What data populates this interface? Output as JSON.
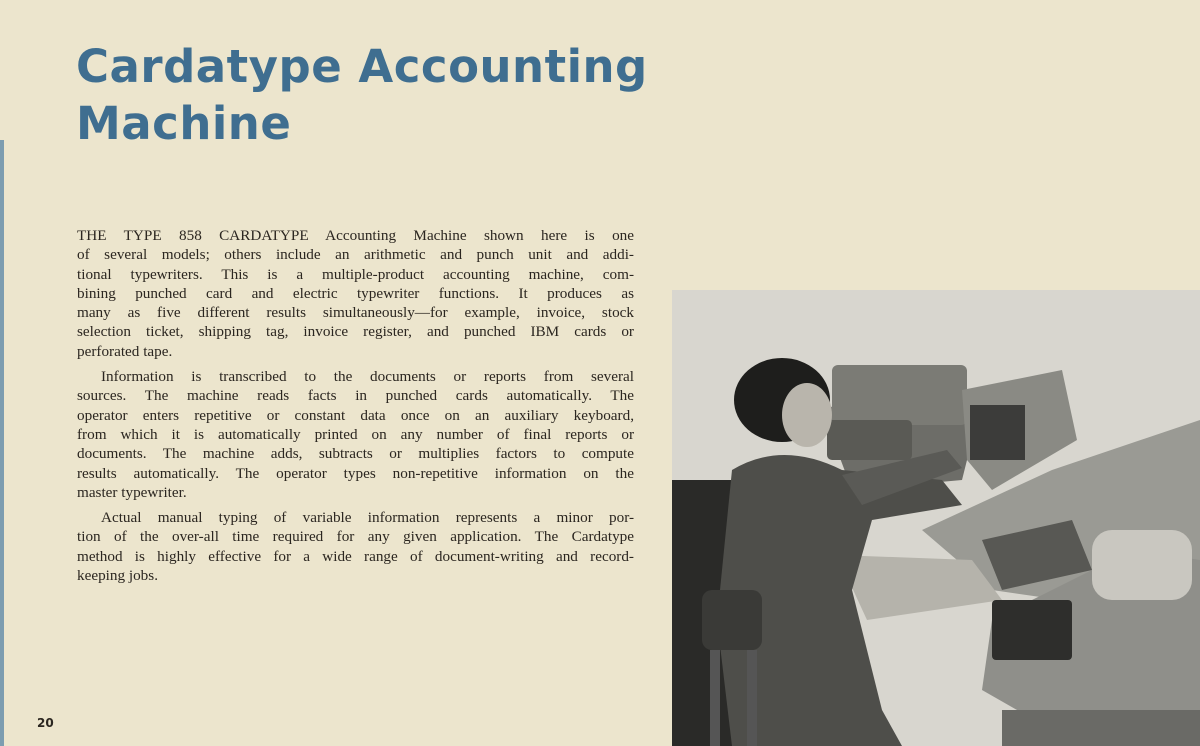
{
  "title": [
    "Cardatype Accounting",
    "Machine"
  ],
  "paragraphs": [
    [
      "THE TYPE 858 CARDATYPE Accounting Machine shown here is one",
      "of several models; others include an arithmetic and punch unit and addi-",
      "tional typewriters. This is a multiple-product accounting machine, com-",
      "bining punched card and electric typewriter functions. It produces as",
      "many as five different results simultaneously—for example, invoice, stock",
      "selection ticket, shipping tag, invoice register, and punched IBM cards or",
      "perforated tape."
    ],
    [
      "Information is transcribed to the documents or reports from several",
      "sources. The machine reads facts in punched cards automatically. The",
      "operator enters repetitive or constant data once on an auxiliary keyboard,",
      "from which it is automatically printed on any number of final reports or",
      "documents. The machine adds, subtracts or multiplies factors to compute",
      "results automatically. The operator types non-repetitive information on the",
      "master typewriter."
    ],
    [
      "Actual manual typing of variable information represents a minor por-",
      "tion of the over-all time required for any given application. The Cardatype",
      "method is highly effective for a wide range of document-writing and record-",
      "keeping jobs."
    ]
  ],
  "page_number": "20",
  "colors": {
    "title": "#3f6e90",
    "paper": "#ece5cd",
    "text": "#2b2620"
  }
}
